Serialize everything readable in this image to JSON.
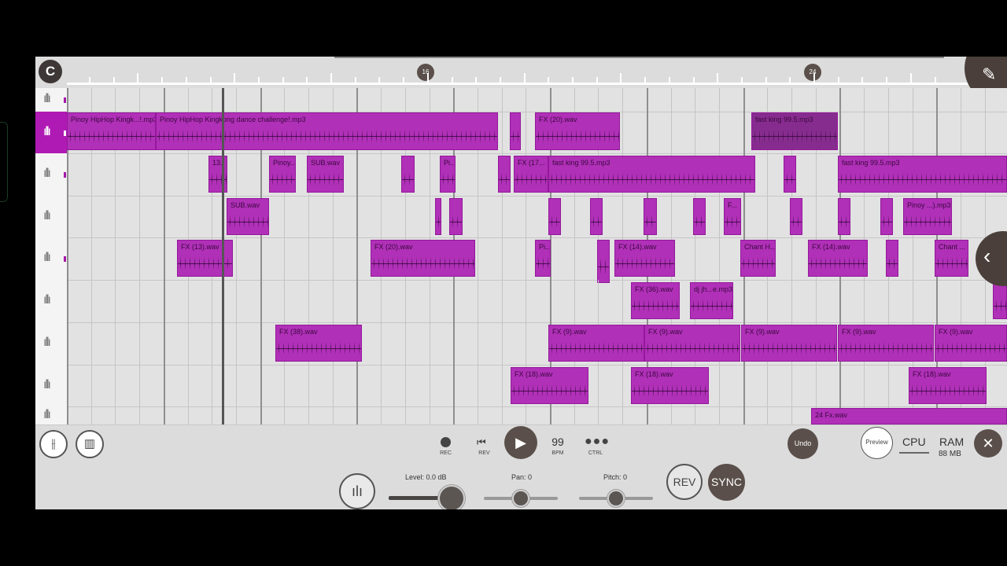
{
  "app": {
    "logo_text": "C",
    "accent": "#b030b7"
  },
  "ruler": {
    "markers": [
      "16",
      "24"
    ]
  },
  "tracks": [
    {
      "clips": []
    },
    {
      "selected": true,
      "clips": [
        {
          "name": "Pinoy HipHop Kingk...!.mp3"
        },
        {
          "name": "Pinoy HipHop Kingkong dance challenge!.mp3"
        },
        {
          "name": ""
        },
        {
          "name": "FX (20).wav"
        },
        {
          "name": "fast king 99.5.mp3"
        }
      ]
    },
    {
      "clips": [
        {
          "name": "13."
        },
        {
          "name": "Pinoy..."
        },
        {
          "name": "SUB.wav"
        },
        {
          "name": ""
        },
        {
          "name": "Pi..."
        },
        {
          "name": ""
        },
        {
          "name": "FX (17..."
        },
        {
          "name": "fast king 99.5.mp3"
        },
        {
          "name": ""
        },
        {
          "name": "fast king 99.5.mp3"
        }
      ]
    },
    {
      "clips": [
        {
          "name": "SUB.wav"
        },
        {
          "name": ""
        },
        {
          "name": ""
        },
        {
          "name": ""
        },
        {
          "name": ""
        },
        {
          "name": ""
        },
        {
          "name": ""
        },
        {
          "name": "F..."
        },
        {
          "name": ""
        },
        {
          "name": ""
        },
        {
          "name": ""
        },
        {
          "name": "Pinoy ...).mp3"
        }
      ]
    },
    {
      "clips": [
        {
          "name": "FX (13).wav"
        },
        {
          "name": "FX (20).wav"
        },
        {
          "name": "Pi..."
        },
        {
          "name": ""
        },
        {
          "name": "FX (14).wav"
        },
        {
          "name": "Chant H..."
        },
        {
          "name": "FX (14).wav"
        },
        {
          "name": ""
        },
        {
          "name": "Chant ..."
        }
      ]
    },
    {
      "clips": [
        {
          "name": "FX (36).wav"
        },
        {
          "name": "dj jh...e.mp3"
        },
        {
          "name": ""
        }
      ]
    },
    {
      "clips": [
        {
          "name": "FX (38).wav"
        },
        {
          "name": "FX (9).wav"
        },
        {
          "name": "FX (9).wav"
        },
        {
          "name": "FX (9).wav"
        },
        {
          "name": "FX (9).wav"
        },
        {
          "name": "FX (9).wav"
        }
      ]
    },
    {
      "clips": [
        {
          "name": "FX (18).wav"
        },
        {
          "name": "FX (18).wav"
        },
        {
          "name": "FX (18).wav"
        }
      ]
    },
    {
      "clips": [
        {
          "name": "24 Fx.wav"
        }
      ]
    }
  ],
  "transport": {
    "rec_label": "REC",
    "rev_label": "REV",
    "bpm_value": "99",
    "bpm_label": "BPM",
    "ctrl_label": "CTRL",
    "undo_label": "Undo",
    "preview_label": "Preview",
    "cpu_label": "CPU",
    "ram_label": "RAM",
    "ram_value": "88 MB"
  },
  "track_controls": {
    "level_label": "Level: 0.0 dB",
    "pan_label": "Pan: 0",
    "pitch_label": "Pitch: 0",
    "level_fraction": 0.85,
    "pan_fraction": 0.5,
    "pitch_fraction": 0.5,
    "rev_button": "REV",
    "sync_button": "SYNC"
  }
}
